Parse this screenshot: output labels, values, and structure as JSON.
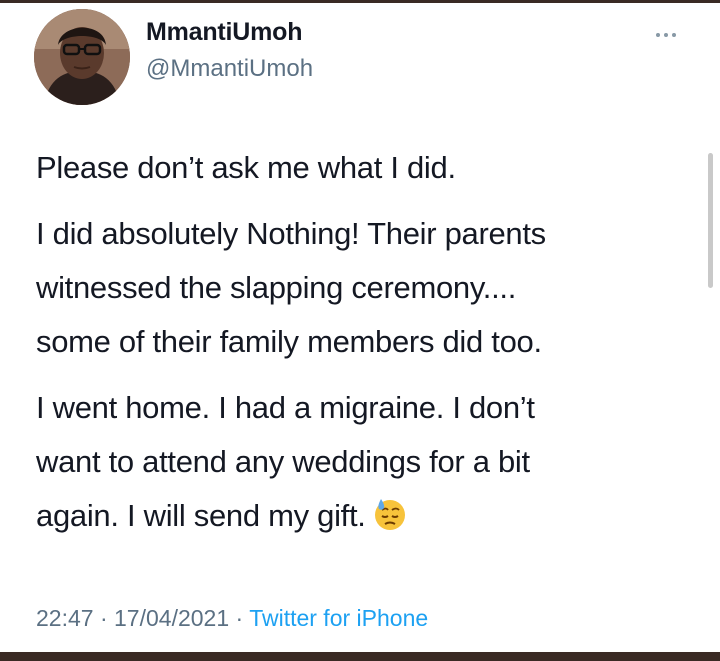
{
  "tweet": {
    "author": {
      "display_name": "MmantiUmoh",
      "handle": "@MmantiUmoh",
      "avatar_icon": "profile-photo"
    },
    "more_icon": "more-horizontal-icon",
    "paragraphs": [
      [
        "Please don’t ask me what I did."
      ],
      [
        "I did absolutely Nothing! Their parents",
        "witnessed the slapping ceremony....",
        "some of their family members did too."
      ],
      [
        "I went home. I had a migraine. I don’t",
        "want to attend any weddings for a bit",
        "again. I will send my gift."
      ]
    ],
    "emoji": "downcast-face-with-sweat-emoji",
    "time": "22:47",
    "separator": "·",
    "date": "17/04/2021",
    "source": "Twitter for iPhone"
  },
  "colors": {
    "text": "#141823",
    "secondary": "#5b7083",
    "link": "#1da1f2",
    "background": "#ffffff",
    "frame": "#3a2a24"
  }
}
